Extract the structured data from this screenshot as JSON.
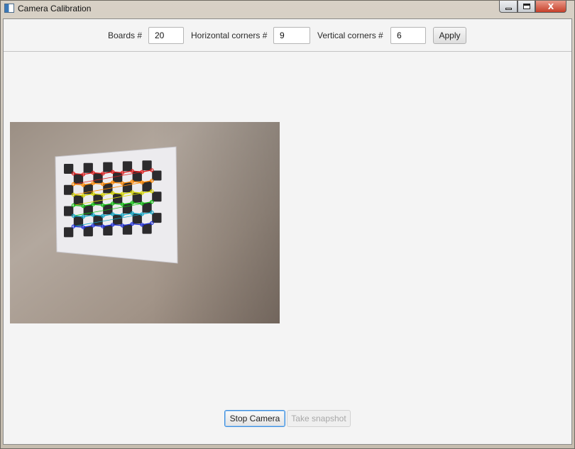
{
  "window": {
    "title": "Camera Calibration",
    "icon": "app-window-icon",
    "controls": {
      "minimize": "minimize-icon",
      "maximize": "maximize-icon",
      "close_glyph": "X"
    }
  },
  "settings": {
    "boards_label": "Boards #",
    "boards_value": "20",
    "h_corners_label": "Horizontal corners #",
    "h_corners_value": "9",
    "v_corners_label": "Vertical corners #",
    "v_corners_value": "6",
    "apply_label": "Apply"
  },
  "camera_feed": {
    "content": "chessboard-with-detected-corners",
    "corner_colors": [
      "#e02020",
      "#ff8800",
      "#d8d800",
      "#10c010",
      "#10a8c8",
      "#2030d8"
    ]
  },
  "actions": {
    "stop_camera_label": "Stop Camera",
    "take_snapshot_label": "Take snapshot",
    "take_snapshot_enabled": false
  }
}
